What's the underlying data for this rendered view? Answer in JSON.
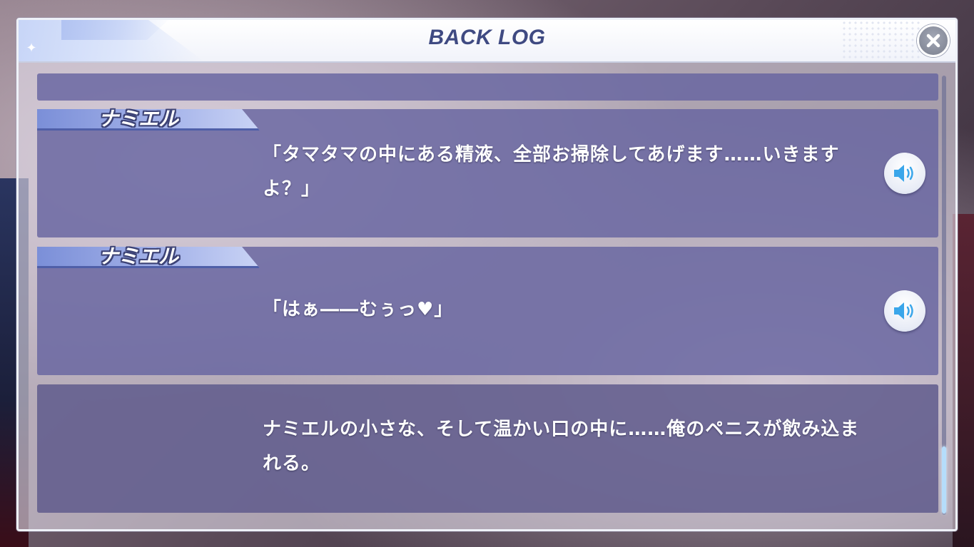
{
  "window": {
    "title": "BACK LOG",
    "close_icon": "close-icon"
  },
  "entries": [
    {
      "type": "partial",
      "speaker": "",
      "text": ""
    },
    {
      "type": "dialogue",
      "speaker": "ナミエル",
      "text": "「タマタマの中にある精液、全部お掃除してあげます……いきますよ？」",
      "voice_icon": "speaker-icon"
    },
    {
      "type": "dialogue",
      "speaker": "ナミエル",
      "text": "「はぁ――むぅっ♥」",
      "voice_icon": "speaker-icon"
    },
    {
      "type": "narration",
      "speaker": "",
      "text": "ナミエルの小さな、そして温かい口の中に……俺のペニスが飲み込まれる。"
    }
  ],
  "scrollbar": {
    "position": 0.85
  },
  "colors": {
    "title": "#3f4a82",
    "entry_bg": "#6764a0",
    "name_tag": "#7b8fd8",
    "scroll_thumb": "#b5ddfb"
  }
}
